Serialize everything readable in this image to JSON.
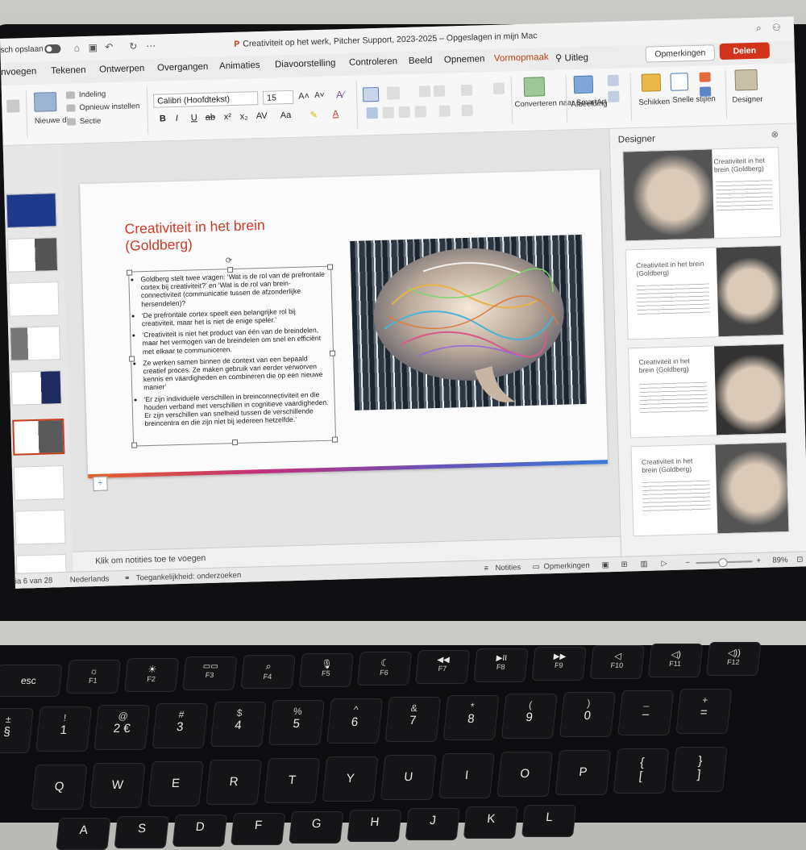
{
  "window": {
    "autosave_label": "sch opslaan",
    "title": "Creativiteit op het werk, Pitcher Support, 2023-2025 – Opgeslagen in mijn Mac",
    "app_badge": "P"
  },
  "tabs": [
    "nvoegen",
    "Tekenen",
    "Ontwerpen",
    "Overgangen",
    "Animaties",
    "Diavoorstelling",
    "Controleren",
    "Beeld",
    "Opnemen",
    "Vormopmaak",
    "Uitleg"
  ],
  "active_tab": "Vormopmaak",
  "header_buttons": {
    "comments": "Opmerkingen",
    "share": "Delen"
  },
  "ribbon": {
    "new_slide": "Nieuwe dia",
    "layout": "Indeling",
    "reset": "Opnieuw instellen",
    "section": "Sectie",
    "font": "Calibri (Hoofdtekst)",
    "font_size": "15",
    "bold": "B",
    "italic": "I",
    "underline": "U",
    "strike": "ab",
    "superscript": "x²",
    "subscript": "x₂",
    "spacing": "AV",
    "case": "Aa",
    "smartart": "Converteren naar SmartArt",
    "picture": "Afbeelding",
    "arrange": "Schikken",
    "quick_styles": "Snelle stijlen",
    "designer": "Designer"
  },
  "slide": {
    "title": "Creativiteit in het brein (Goldberg)",
    "bullets": [
      "Goldberg stelt twee vragen: ‘Wat is de rol van de prefrontale cortex bij creativiteit?’ en ‘Wat is de rol van brein-connectiviteit (communicatie tussen de afzonderlijke hersendelen)?",
      "‘De prefrontale cortex speelt een belangrijke rol bij creativiteit, maar het is niet de enige speler.’",
      "‘Creativiteit is niet het product van één van de breindelen, maar het vermogen van de breindelen om snel en efficiënt met elkaar te communiceren.",
      "Ze werken samen binnen de context van een bepaald creatief proces. Ze maken gebruik van eerder verworven kennis en vaardigheden en combineren die op een nieuwe manier’",
      "‘Er zijn individuele verschillen in breinconnectiviteit en die houden verband met verschillen in cognitieve vaardigheden. Er zijn verschillen van snelheid tussen de verschillende breincentra en die zijn niet bij iedereen hetzelfde.’"
    ]
  },
  "notes_placeholder": "Klik om notities toe te voegen",
  "designer": {
    "heading": "Designer",
    "card_titles": [
      "Creativiteit in het brein (Goldberg)",
      "Creativiteit in het brein (Goldberg)",
      "Creativiteit in het brein (Goldberg)",
      "Creativiteit in het brein (Goldberg)"
    ]
  },
  "status": {
    "slide_position": "ia 6 van 28",
    "language": "Nederlands",
    "accessibility": "Toegankelijkheid: onderzoeken",
    "notes_btn": "Notities",
    "comments_btn": "Opmerkingen",
    "zoom": "89%"
  },
  "keyboard": {
    "fn_row": [
      {
        "main": "esc",
        "sub": ""
      },
      {
        "main": "☼",
        "sub": "F1"
      },
      {
        "main": "☀",
        "sub": "F2"
      },
      {
        "main": "▭▭",
        "sub": "F3"
      },
      {
        "main": "⌕",
        "sub": "F4"
      },
      {
        "main": "🎙",
        "sub": "F5"
      },
      {
        "main": "☾",
        "sub": "F6"
      },
      {
        "main": "◀◀",
        "sub": "F7"
      },
      {
        "main": "▶II",
        "sub": "F8"
      },
      {
        "main": "▶▶",
        "sub": "F9"
      },
      {
        "main": "◁",
        "sub": "F10"
      },
      {
        "main": "◁)",
        "sub": "F11"
      },
      {
        "main": "◁))",
        "sub": "F12"
      }
    ],
    "num_row": [
      {
        "main": "§",
        "sub": "±"
      },
      {
        "main": "1",
        "sub": "!"
      },
      {
        "main": "2 €",
        "sub": "@"
      },
      {
        "main": "3",
        "sub": "#"
      },
      {
        "main": "4",
        "sub": "$"
      },
      {
        "main": "5",
        "sub": "%"
      },
      {
        "main": "6",
        "sub": "^"
      },
      {
        "main": "7",
        "sub": "&"
      },
      {
        "main": "8",
        "sub": "*"
      },
      {
        "main": "9",
        "sub": "("
      },
      {
        "main": "0",
        "sub": ")"
      },
      {
        "main": "–",
        "sub": "_"
      },
      {
        "main": "=",
        "sub": "+"
      }
    ],
    "top_row": [
      "Q",
      "W",
      "E",
      "R",
      "T",
      "Y",
      "U",
      "I",
      "O",
      "P"
    ],
    "bottom_row": [
      "A",
      "S",
      "D",
      "F",
      "G",
      "H",
      "J",
      "K",
      "L"
    ]
  }
}
